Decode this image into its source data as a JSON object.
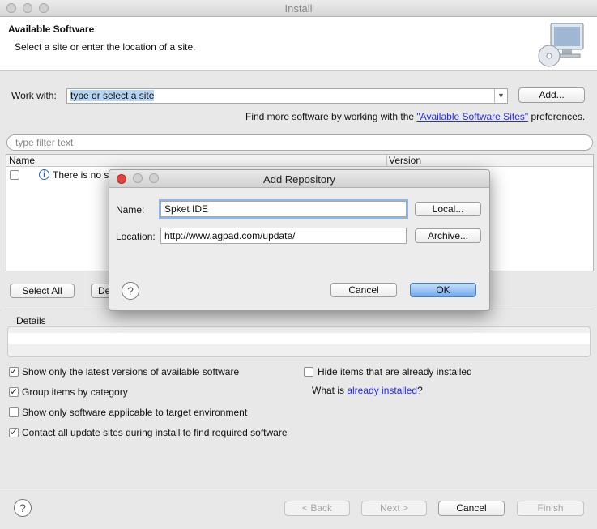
{
  "window": {
    "title": "Install"
  },
  "header": {
    "title": "Available Software",
    "subtitle": "Select a site or enter the location of a site."
  },
  "work_with": {
    "label": "Work with:",
    "value": "type or select a site",
    "add_label": "Add...",
    "find_more_prefix": "Find more software by working with the ",
    "find_more_link": "\"Available Software Sites\"",
    "find_more_suffix": " preferences."
  },
  "filter": {
    "placeholder": "type filter text"
  },
  "table": {
    "columns": [
      "Name",
      "Version"
    ],
    "rows": [
      {
        "text": "There is no si"
      }
    ]
  },
  "selection_buttons": {
    "select_all": "Select All",
    "deselect_partial": "De"
  },
  "details": {
    "label": "Details"
  },
  "options": {
    "show_latest": {
      "label": "Show only the latest versions of available software",
      "checked": true
    },
    "group_by_category": {
      "label": "Group items by category",
      "checked": true
    },
    "only_applicable": {
      "label": "Show only software applicable to target environment",
      "checked": false
    },
    "contact_all": {
      "label": "Contact all update sites during install to find required software",
      "checked": true
    },
    "hide_installed": {
      "label": "Hide items that are already installed",
      "checked": false
    },
    "what_is_prefix": "What is ",
    "what_is_link": "already installed",
    "what_is_suffix": "?"
  },
  "footer": {
    "back": "< Back",
    "next": "Next >",
    "cancel": "Cancel",
    "finish": "Finish"
  },
  "dialog": {
    "title": "Add Repository",
    "name_label": "Name:",
    "name_value": "Spket IDE",
    "local_label": "Local...",
    "location_label": "Location:",
    "location_value": "http://www.agpad.com/update/",
    "archive_label": "Archive...",
    "cancel_label": "Cancel",
    "ok_label": "OK"
  },
  "colors": {
    "accent": "#2a2ae0",
    "primary_button": "#6fa9ec",
    "close_dot": "#e0443e"
  }
}
